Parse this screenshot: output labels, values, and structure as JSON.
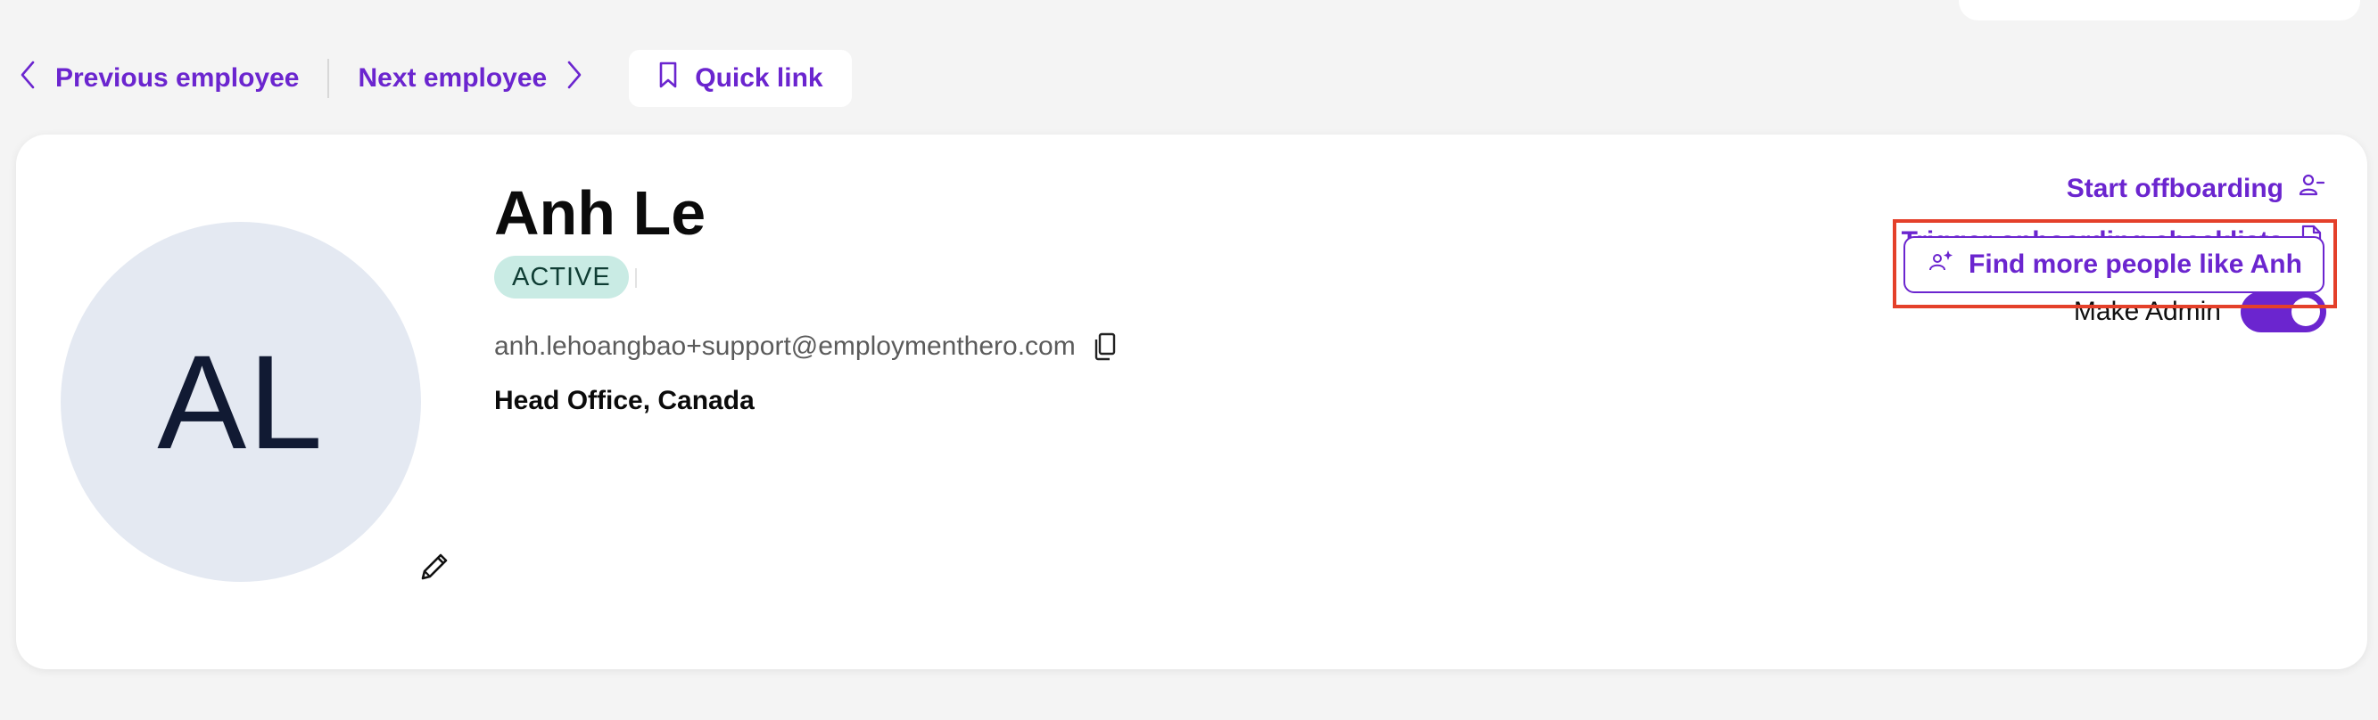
{
  "nav": {
    "previous_label": "Previous employee",
    "next_label": "Next employee",
    "quick_link_label": "Quick link"
  },
  "profile": {
    "initials": "AL",
    "name": "Anh Le",
    "status": "ACTIVE",
    "email": "anh.lehoangbao+support@employmenthero.com",
    "location": "Head Office, Canada"
  },
  "actions": {
    "offboarding_label": "Start offboarding",
    "onboarding_label": "Trigger onboarding checklists",
    "make_admin_label": "Make Admin",
    "make_admin_enabled": true,
    "find_similar_label": "Find more people like Anh"
  },
  "icons": {
    "previous": "chevron-left-icon",
    "next": "chevron-right-icon",
    "quick_link": "bookmark-icon",
    "edit_avatar": "pencil-icon",
    "copy_email": "copy-icon",
    "offboarding": "user-minus-icon",
    "onboarding": "document-icon",
    "find_similar": "sparkle-people-icon"
  },
  "colors": {
    "accent": "#6b25cf",
    "status_badge_bg": "#c9ebe4",
    "avatar_bg": "#e4e9f2",
    "highlight": "#e4402a"
  }
}
